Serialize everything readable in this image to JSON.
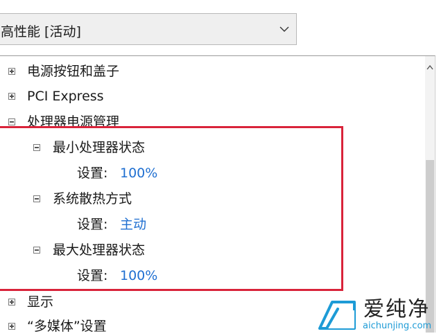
{
  "plan_dropdown": {
    "selected": "高性能 [活动]",
    "chevron_icon": "chevron-down-icon"
  },
  "tree": {
    "items": [
      {
        "label": "电源按钮和盖子",
        "expanded": false
      },
      {
        "label": "PCI Express",
        "expanded": false
      },
      {
        "label": "处理器电源管理",
        "expanded": true
      },
      {
        "label": "显示",
        "expanded": false
      },
      {
        "label": "“多媒体”设置",
        "expanded": false
      }
    ],
    "processor_children": [
      {
        "label": "最小处理器状态",
        "setting_key": "设置:",
        "setting_value": "100%"
      },
      {
        "label": "系统散热方式",
        "setting_key": "设置:",
        "setting_value": "主动"
      },
      {
        "label": "最大处理器状态",
        "setting_key": "设置:",
        "setting_value": "100%"
      }
    ]
  },
  "watermark": {
    "title": "爱纯净",
    "url": "aichunjing.com"
  },
  "colors": {
    "setting_value": "#1f6fd1",
    "highlight": "#d9233a",
    "watermark_url": "#1d9bd6"
  }
}
